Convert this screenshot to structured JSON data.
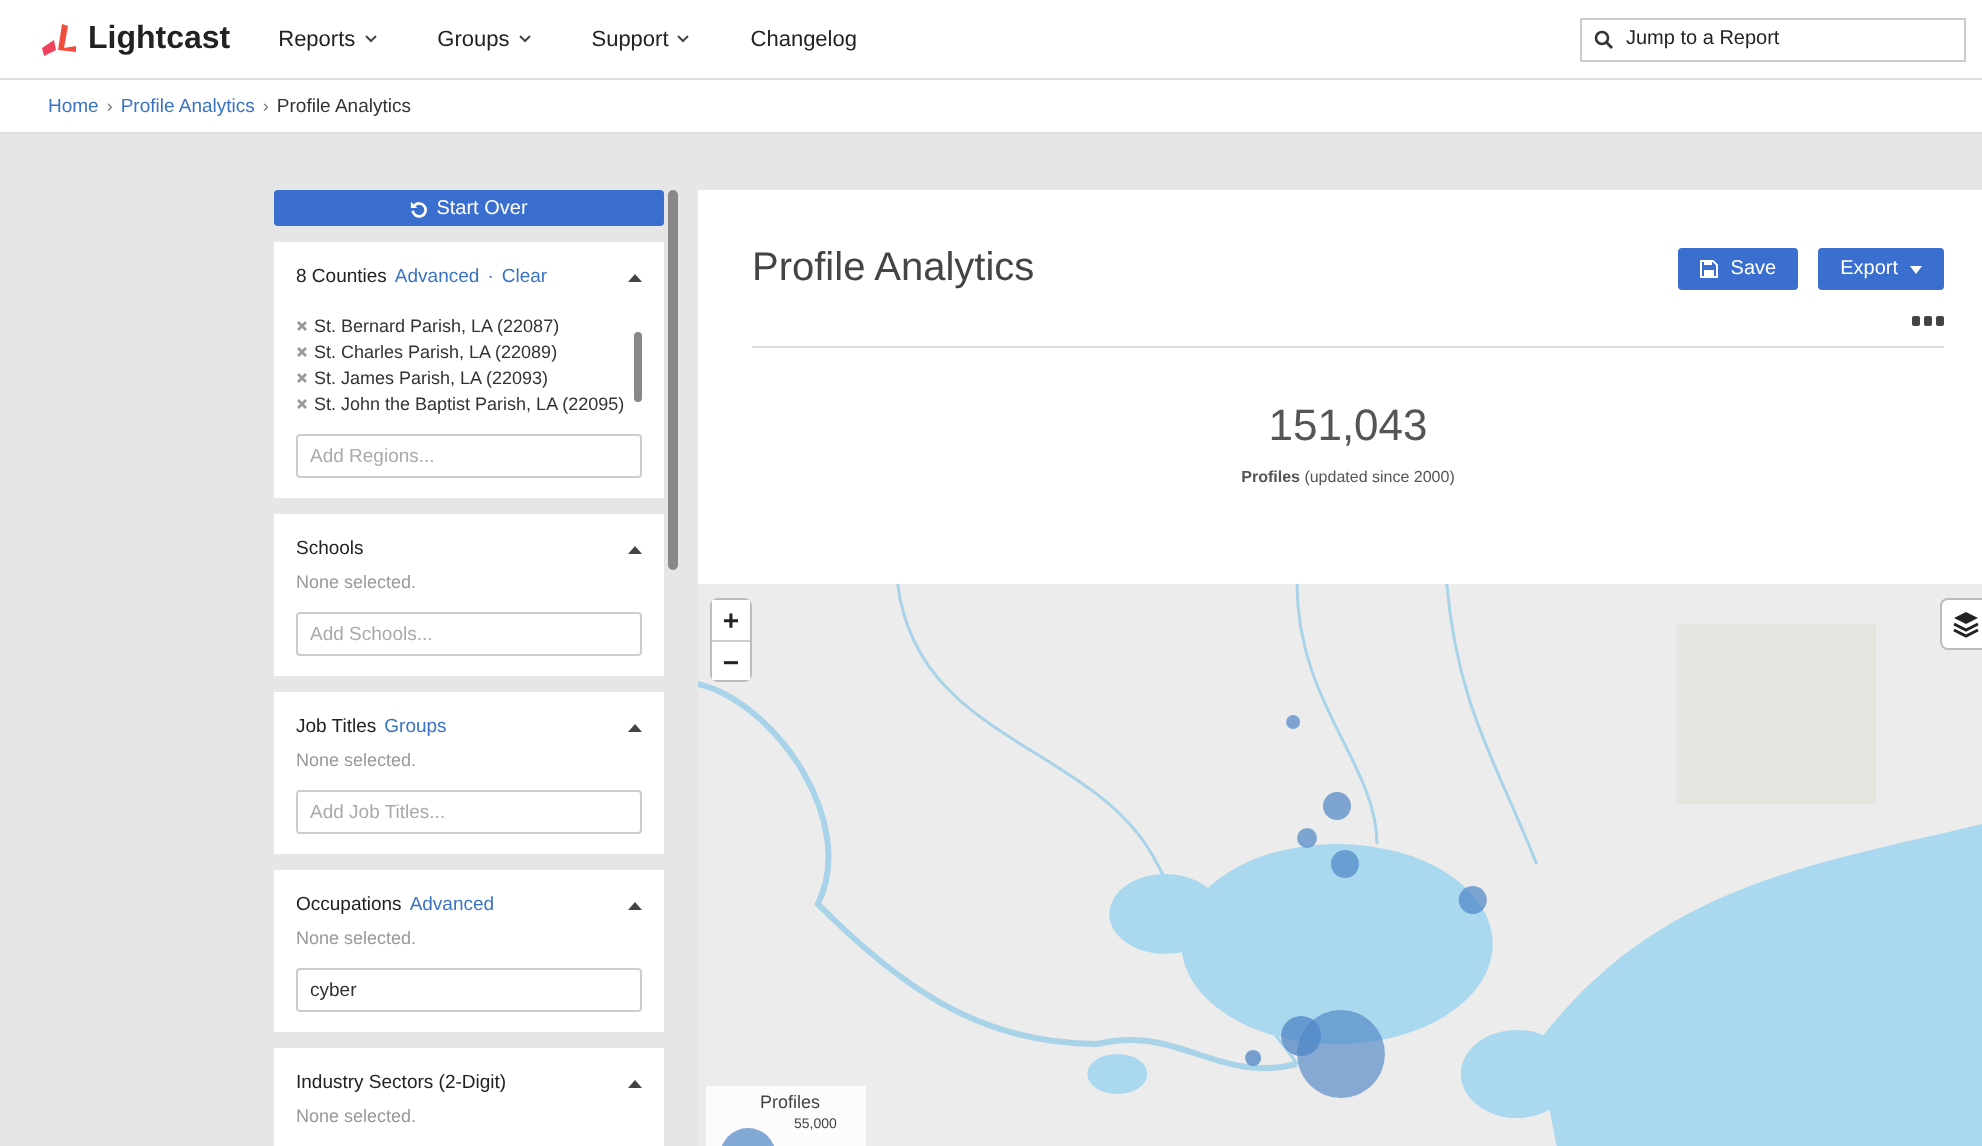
{
  "nav": {
    "brand": "Lightcast",
    "menus": [
      {
        "label": "Reports",
        "dropdown": true
      },
      {
        "label": "Groups",
        "dropdown": true
      },
      {
        "label": "Support",
        "dropdown": true
      },
      {
        "label": "Changelog",
        "dropdown": false
      }
    ],
    "search": {
      "placeholder": "Jump to a Report"
    }
  },
  "breadcrumb": [
    {
      "label": "Home",
      "link": true
    },
    {
      "separator_before": "›",
      "label": "Profile Analytics",
      "link": true
    },
    {
      "separator_before": "›",
      "label": "Profile Analytics",
      "link": false
    }
  ],
  "sidebar": {
    "start_over": "Start Over",
    "filters": [
      {
        "title": "8 Counties",
        "links": [
          {
            "label": "Advanced"
          },
          {
            "separator_before": "·",
            "label": "Clear"
          }
        ],
        "expanded": true,
        "items": [
          "St. Bernard Parish, LA (22087)",
          "St. Charles Parish, LA (22089)",
          "St. James Parish, LA (22093)",
          "St. John the Baptist Parish, LA (22095)"
        ],
        "placeholder": "Add Regions..."
      },
      {
        "title": "Schools",
        "expanded": true,
        "status": "None selected.",
        "placeholder": "Add Schools..."
      },
      {
        "title": "Job Titles",
        "links": [
          {
            "label": "Groups"
          }
        ],
        "expanded": true,
        "status": "None selected.",
        "placeholder": "Add Job Titles..."
      },
      {
        "title": "Occupations",
        "links": [
          {
            "label": "Advanced"
          }
        ],
        "expanded": true,
        "status": "None selected.",
        "value": "cyber"
      },
      {
        "title": "Industry Sectors (2-Digit)",
        "expanded": true,
        "status": "None selected."
      }
    ]
  },
  "main": {
    "title": "Profile Analytics",
    "save": "Save",
    "export": "Export",
    "stat": {
      "value": "151,043",
      "label": "**Profiles** (updated since 2000)"
    }
  },
  "map": {
    "kind": "picture",
    "zoom_in": "+",
    "zoom_out": "−",
    "legend": {
      "title": "Profiles",
      "value": "55,000"
    }
  }
}
